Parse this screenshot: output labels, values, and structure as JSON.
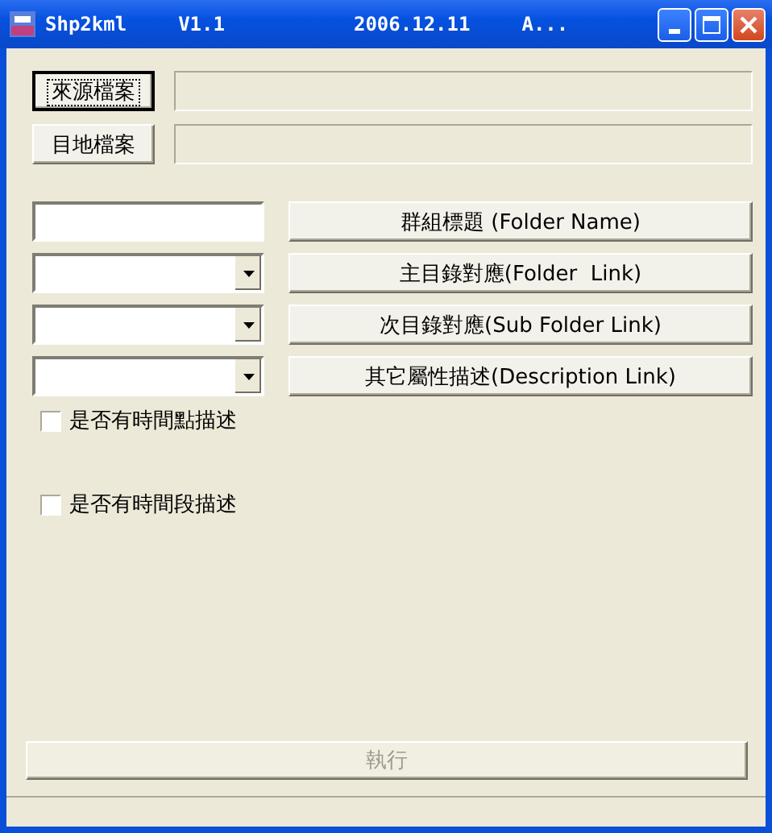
{
  "window": {
    "title_parts": [
      "Shp2kml",
      "V1.1",
      "2006.12.11",
      "A..."
    ]
  },
  "file_rows": [
    {
      "button": "來源檔案",
      "focused": true,
      "value": ""
    },
    {
      "button": "目地檔案",
      "focused": false,
      "value": ""
    }
  ],
  "field_rows": [
    {
      "kind": "text",
      "button": "群組標題 (Folder Name)"
    },
    {
      "kind": "dropdown",
      "button": "主目錄對應(Folder  Link)"
    },
    {
      "kind": "dropdown",
      "button": "次目錄對應(Sub Folder Link)"
    },
    {
      "kind": "dropdown",
      "button": "其它屬性描述(Description Link)"
    }
  ],
  "checkboxes": [
    {
      "label": "是否有時間點描述",
      "checked": false
    },
    {
      "label": "是否有時間段描述",
      "checked": false
    }
  ],
  "execute_button": {
    "label": "執行",
    "disabled": true
  }
}
